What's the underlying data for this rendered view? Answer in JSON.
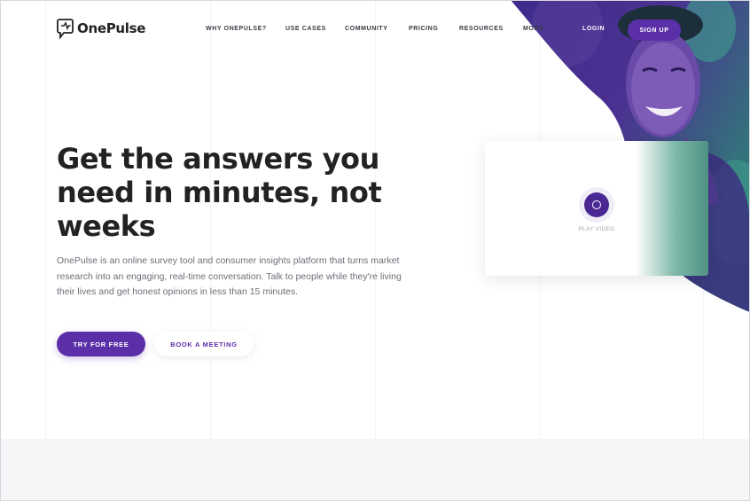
{
  "brand": {
    "name": "OnePulse"
  },
  "nav": {
    "items": [
      {
        "label": "WHY ONEPULSE?"
      },
      {
        "label": "USE CASES"
      },
      {
        "label": "COMMUNITY"
      },
      {
        "label": "PRICING"
      },
      {
        "label": "RESOURCES"
      },
      {
        "label": "MORE"
      }
    ],
    "login": "LOGIN",
    "signup": "SIGN UP"
  },
  "hero": {
    "title": "Get the answers you need in minutes, not weeks",
    "description": "OnePulse is an online survey tool and consumer insights platform that turns market research into an engaging, real-time conversation. Talk to people while they're living their lives and get honest opinions in less than 15 minutes.",
    "primary_cta": "TRY FOR FREE",
    "secondary_cta": "BOOK A MEETING"
  },
  "video": {
    "label": "PLAY VIDEO"
  },
  "colors": {
    "brand_purple": "#5b2fa8",
    "dark_purple": "#4a2894",
    "teal": "#3f8f82"
  }
}
